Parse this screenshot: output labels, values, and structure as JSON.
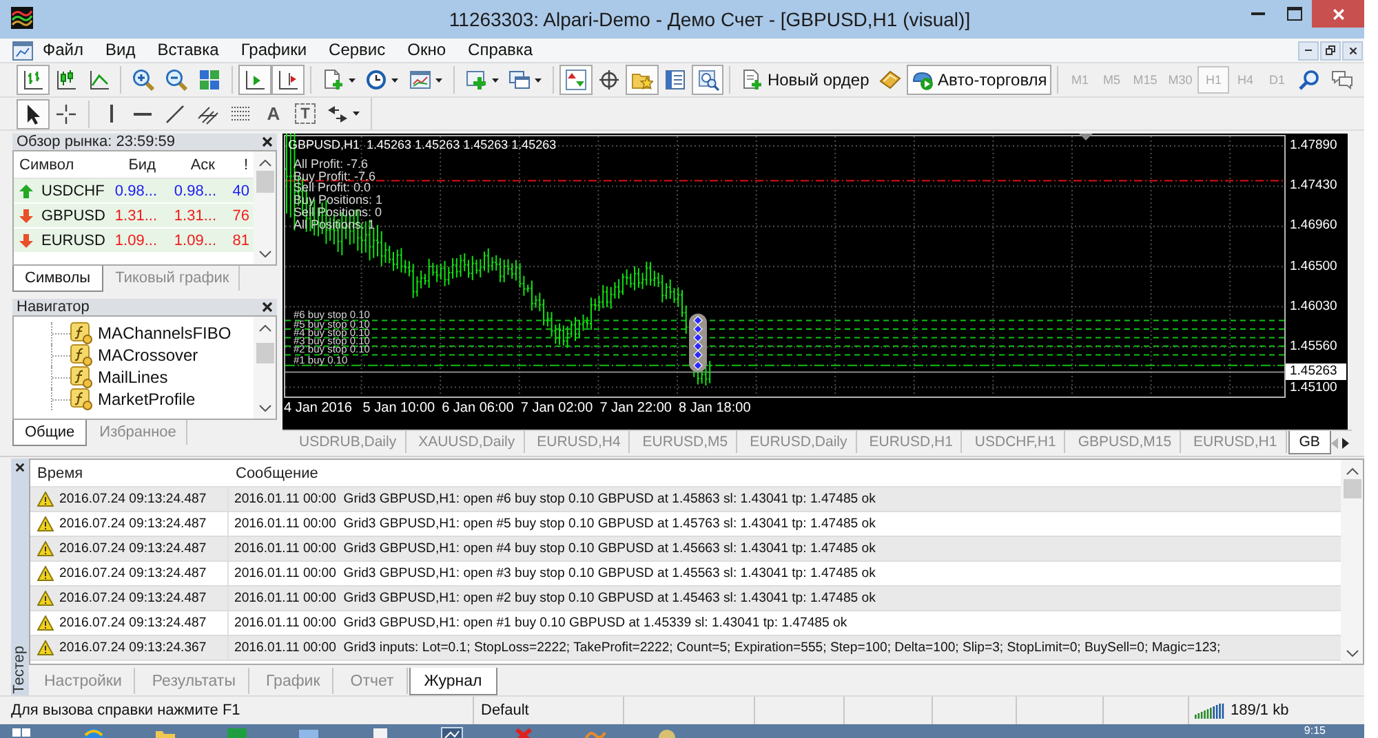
{
  "window": {
    "title": "11263303: Alpari-Demo - Демо Счет - [GBPUSD,H1 (visual)]"
  },
  "menu": [
    "Файл",
    "Вид",
    "Вставка",
    "Графики",
    "Сервис",
    "Окно",
    "Справка"
  ],
  "toolbar": [
    {
      "kind": "bar-chart",
      "pressed": true
    },
    {
      "kind": "candles",
      "pressed": false
    },
    {
      "kind": "line-chart",
      "pressed": false
    },
    {
      "kind": "separator"
    },
    {
      "kind": "zoom-in",
      "pressed": false
    },
    {
      "kind": "zoom-out",
      "pressed": false
    },
    {
      "kind": "tile",
      "pressed": false
    },
    {
      "kind": "separator"
    },
    {
      "kind": "autoscroll",
      "pressed": true
    },
    {
      "kind": "chart-shift",
      "pressed": true
    },
    {
      "kind": "separator"
    },
    {
      "kind": "new-chart",
      "pressed": false
    },
    {
      "kind": "periods",
      "pressed": false
    },
    {
      "kind": "templates",
      "pressed": false
    },
    {
      "kind": "separator"
    },
    {
      "kind": "indicators",
      "pressed": false
    },
    {
      "kind": "windows",
      "pressed": false
    },
    {
      "kind": "separator"
    },
    {
      "kind": "market-watch",
      "pressed": true
    },
    {
      "kind": "crosshair",
      "pressed": false
    },
    {
      "kind": "navigator",
      "pressed": true
    },
    {
      "kind": "terminal",
      "pressed": false
    },
    {
      "kind": "tester",
      "pressed": true
    },
    {
      "kind": "separator"
    },
    {
      "kind": "new-order",
      "label": "Новый ордер",
      "pressed": false
    },
    {
      "kind": "meta-editor",
      "pressed": false
    },
    {
      "kind": "auto-trading",
      "label": "Авто-торговля",
      "pressed": true
    }
  ],
  "timeframes": {
    "disabled": true,
    "items": [
      {
        "label": "M1",
        "selected": false
      },
      {
        "label": "M5",
        "selected": false
      },
      {
        "label": "M15",
        "selected": false
      },
      {
        "label": "M30",
        "selected": false
      },
      {
        "label": "H1",
        "selected": true
      },
      {
        "label": "H4",
        "selected": false
      },
      {
        "label": "D1",
        "selected": false
      }
    ]
  },
  "drawing_tools": [
    {
      "kind": "cursor",
      "pressed": true
    },
    {
      "kind": "crosshair-thin",
      "pressed": false
    },
    {
      "kind": "separator"
    },
    {
      "kind": "vertical-line",
      "pressed": false
    },
    {
      "kind": "horizontal-line",
      "pressed": false
    },
    {
      "kind": "trendline",
      "pressed": false
    },
    {
      "kind": "channel",
      "pressed": false
    },
    {
      "kind": "fibo",
      "pressed": false
    },
    {
      "kind": "text",
      "glyph": "A",
      "pressed": false
    },
    {
      "kind": "label",
      "glyph": "T",
      "pressed": false
    },
    {
      "kind": "arrows",
      "pressed": false
    }
  ],
  "market_watch": {
    "title": "Обзор рынка: 23:59:59",
    "columns": [
      "Символ",
      "Бид",
      "Аск",
      "!"
    ],
    "rows": [
      {
        "rising": true,
        "cells": [
          "USDCHF",
          "0.98...",
          "0.98...",
          "40"
        ]
      },
      {
        "rising": false,
        "cells": [
          "GBPUSD",
          "1.31...",
          "1.31...",
          "76"
        ]
      },
      {
        "rising": false,
        "cells": [
          "EURUSD",
          "1.09...",
          "1.09...",
          "81"
        ]
      }
    ],
    "tabs": [
      {
        "label": "Символы",
        "selected": true
      },
      {
        "label": "Тиковый график",
        "selected": false
      }
    ]
  },
  "navigator": {
    "title": "Навигатор",
    "items": [
      "MAChannelsFIBO",
      "MACrossover",
      "MailLines",
      "MarketProfile"
    ],
    "tabs": [
      {
        "label": "Общие",
        "selected": true
      },
      {
        "label": "Избранное",
        "selected": false
      }
    ]
  },
  "chart": {
    "header": "GBPUSD,H1  1.45263 1.45263 1.45263 1.45263",
    "stats": [
      "All Profit: -7.6",
      "Buy Profit: -7.6",
      "Sell Profit: 0.0",
      "Buy Positions: 1",
      "Sell Positions: 0",
      "All Positions: 1"
    ],
    "orders": [
      {
        "label": "#6 buy stop 0.10",
        "kind": "pending"
      },
      {
        "label": "#5 buy stop 0.10",
        "kind": "pending"
      },
      {
        "label": "#4 buy stop 0.10",
        "kind": "pending"
      },
      {
        "label": "#3 buy stop 0.10",
        "kind": "pending"
      },
      {
        "label": "#2 buy stop 0.10",
        "kind": "pending"
      },
      {
        "label": "#1 buy 0.10",
        "kind": "market"
      }
    ],
    "price_scale": [
      "1.47890",
      "1.47430",
      "1.46960",
      "1.46500",
      "1.46030",
      "1.45560",
      "1.45100"
    ],
    "current_price": "1.45263",
    "time_scale": [
      "4 Jan 2016",
      "5 Jan 10:00",
      "6 Jan 06:00",
      "7 Jan 02:00",
      "7 Jan 22:00",
      "8 Jan 18:00"
    ]
  },
  "chart_tabs": [
    {
      "label": "USDRUB,Daily",
      "selected": false
    },
    {
      "label": "XAUUSD,Daily",
      "selected": false
    },
    {
      "label": "EURUSD,H4",
      "selected": false
    },
    {
      "label": "EURUSD,M5",
      "selected": false
    },
    {
      "label": "EURUSD,Daily",
      "selected": false
    },
    {
      "label": "EURUSD,H1",
      "selected": false
    },
    {
      "label": "USDCHF,H1",
      "selected": false
    },
    {
      "label": "GBPUSD,M15",
      "selected": false
    },
    {
      "label": "EURUSD,H1",
      "selected": false
    },
    {
      "label": "GB",
      "selected": true
    }
  ],
  "tester": {
    "title": "Тестер",
    "columns": [
      "Время",
      "Сообщение"
    ],
    "rows": [
      {
        "kind": "warning",
        "time": "2016.07.24 09:13:24.487",
        "message": "2016.01.11 00:00  Grid3 GBPUSD,H1: open #6 buy stop 0.10 GBPUSD at 1.45863 sl: 1.43041 tp: 1.47485 ok"
      },
      {
        "kind": "warning",
        "time": "2016.07.24 09:13:24.487",
        "message": "2016.01.11 00:00  Grid3 GBPUSD,H1: open #5 buy stop 0.10 GBPUSD at 1.45763 sl: 1.43041 tp: 1.47485 ok"
      },
      {
        "kind": "warning",
        "time": "2016.07.24 09:13:24.487",
        "message": "2016.01.11 00:00  Grid3 GBPUSD,H1: open #4 buy stop 0.10 GBPUSD at 1.45663 sl: 1.43041 tp: 1.47485 ok"
      },
      {
        "kind": "warning",
        "time": "2016.07.24 09:13:24.487",
        "message": "2016.01.11 00:00  Grid3 GBPUSD,H1: open #3 buy stop 0.10 GBPUSD at 1.45563 sl: 1.43041 tp: 1.47485 ok"
      },
      {
        "kind": "warning",
        "time": "2016.07.24 09:13:24.487",
        "message": "2016.01.11 00:00  Grid3 GBPUSD,H1: open #2 buy stop 0.10 GBPUSD at 1.45463 sl: 1.43041 tp: 1.47485 ok"
      },
      {
        "kind": "warning",
        "time": "2016.07.24 09:13:24.487",
        "message": "2016.01.11 00:00  Grid3 GBPUSD,H1: open #1 buy 0.10 GBPUSD at 1.45339 sl: 1.43041 tp: 1.47485 ok"
      },
      {
        "kind": "warning",
        "time": "2016.07.24 09:13:24.367",
        "message": "2016.01.11 00:00  Grid3 inputs: Lot=0.1; StopLoss=2222; TakeProfit=2222; Count=5; Expiration=555; Step=100; Delta=100; Slip=3; StopLimit=0; BuySell=0; Magic=123;"
      }
    ],
    "tabs": [
      {
        "label": "Настройки",
        "selected": false
      },
      {
        "label": "Результаты",
        "selected": false
      },
      {
        "label": "График",
        "selected": false
      },
      {
        "label": "Отчет",
        "selected": false
      },
      {
        "label": "Журнал",
        "selected": true
      }
    ]
  },
  "status_bar": {
    "help": "Для вызова справки нажмите F1",
    "profile": "Default",
    "traffic": "189/1 kb"
  },
  "taskbar": {
    "clock": "9:15"
  }
}
